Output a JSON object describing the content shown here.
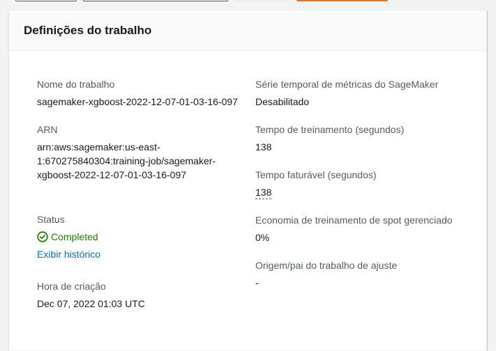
{
  "panel": {
    "title": "Definições do trabalho"
  },
  "left": {
    "job_name_label": "Nome do trabalho",
    "job_name_value": "sagemaker-xgboost-2022-12-07-01-03-16-097",
    "arn_label": "ARN",
    "arn_value": "arn:aws:sagemaker:us-east-1:670275840304:training-job/sagemaker-xgboost-2022-12-07-01-03-16-097",
    "status_label": "Status",
    "status_value": "Completed",
    "history_link": "Exibir histórico",
    "creation_label": "Hora de criação",
    "creation_value": "Dec 07, 2022 01:03 UTC"
  },
  "right": {
    "metrics_label": "Série temporal de métricas do SageMaker",
    "metrics_value": "Desabilitado",
    "training_time_label": "Tempo de treinamento (segundos)",
    "training_time_value": "138",
    "billable_label": "Tempo faturável (segundos)",
    "billable_value": "138",
    "spot_label": "Economia de treinamento de spot gerenciado",
    "spot_value": "0%",
    "tuning_label": "Origem/pai do trabalho de ajuste",
    "tuning_value": "-"
  },
  "colors": {
    "success": "#1d8102",
    "link": "#0073bb",
    "primary_button": "#ec7211"
  },
  "icons": {
    "status": "check-circle-icon"
  }
}
